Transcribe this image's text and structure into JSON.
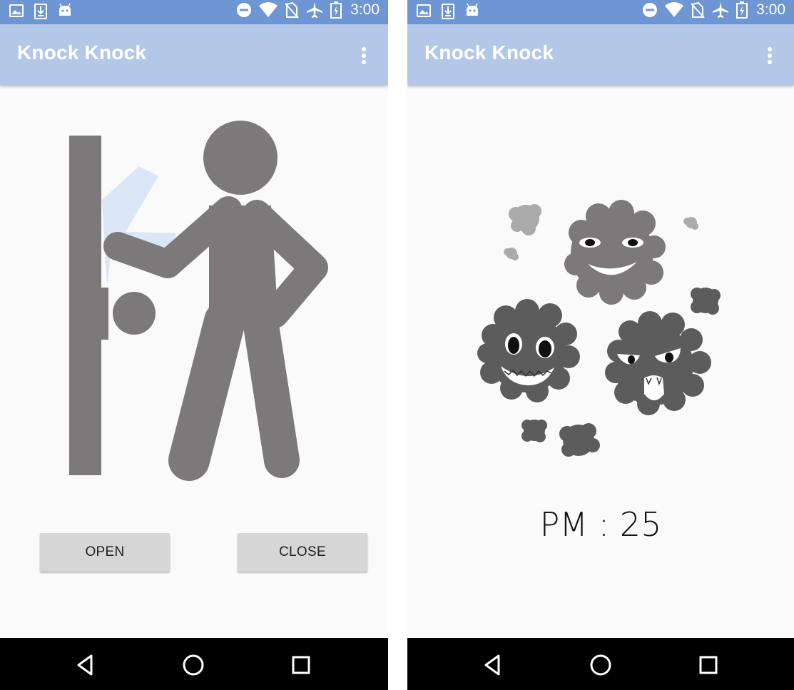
{
  "status_bar": {
    "time": "3:00",
    "left_icons": [
      "image-icon",
      "download-icon",
      "android-icon"
    ],
    "right_icons": [
      "do-not-disturb-icon",
      "wifi-icon",
      "no-sim-icon",
      "airplane-icon",
      "battery-charging-icon"
    ]
  },
  "screens": [
    {
      "app_title": "Knock Knock",
      "illustration": "person-knocking-on-door",
      "buttons": {
        "open_label": "OPEN",
        "close_label": "CLOSE"
      }
    },
    {
      "app_title": "Knock Knock",
      "illustration": "dust-monsters",
      "pm_readout": "PM : 25"
    }
  ],
  "colors": {
    "status_bar": "#6f96d4",
    "app_bar": "#b3c7e8",
    "background": "#fafafa",
    "figure": "#7b797a",
    "burst": "#dae5f5",
    "button": "#d6d6d6",
    "nav_bar": "#000000"
  },
  "nav": [
    "back-icon",
    "home-icon",
    "recents-icon"
  ]
}
